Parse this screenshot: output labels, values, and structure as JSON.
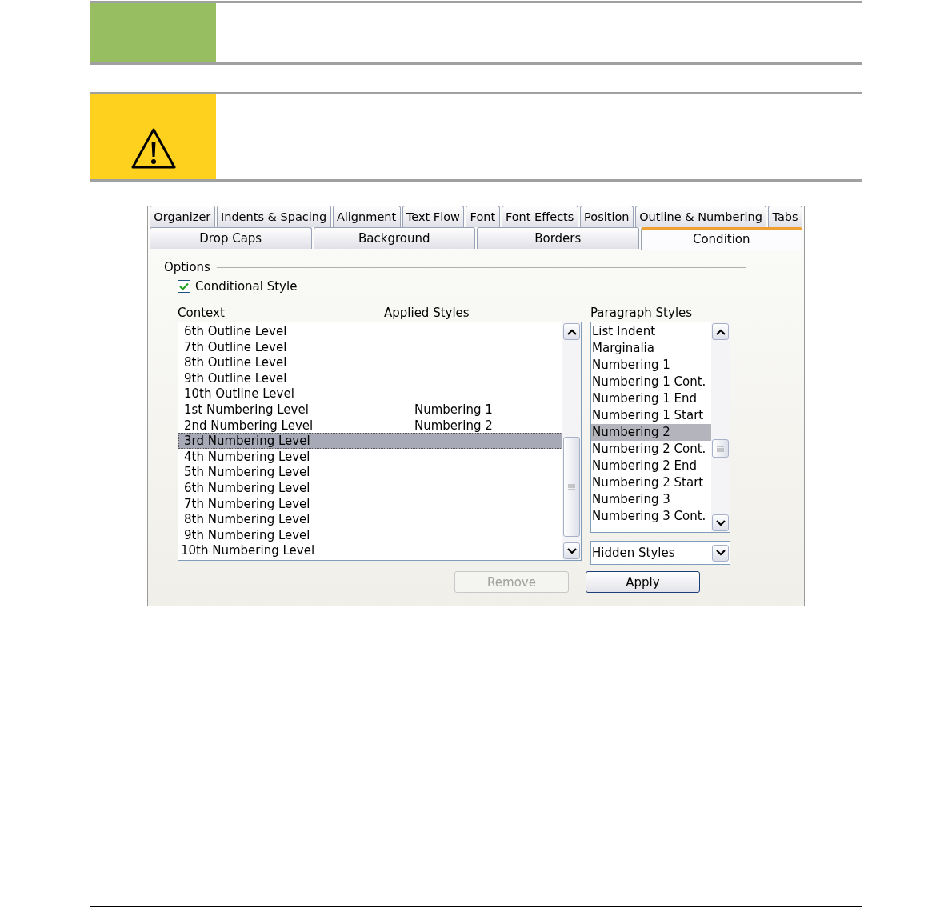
{
  "notes": [
    {
      "kind": "tip"
    },
    {
      "kind": "caution"
    }
  ],
  "dialog": {
    "tab_rows": [
      [
        {
          "label": "Organizer",
          "selected": false
        },
        {
          "label": "Indents & Spacing",
          "selected": false
        },
        {
          "label": "Alignment",
          "selected": false
        },
        {
          "label": "Text Flow",
          "selected": false
        },
        {
          "label": "Font",
          "selected": false
        },
        {
          "label": "Font Effects",
          "selected": false
        },
        {
          "label": "Position",
          "selected": false
        },
        {
          "label": "Outline & Numbering",
          "selected": false
        },
        {
          "label": "Tabs",
          "selected": false
        }
      ],
      [
        {
          "label": "Drop Caps",
          "selected": false
        },
        {
          "label": "Background",
          "selected": false
        },
        {
          "label": "Borders",
          "selected": false
        },
        {
          "label": "Condition",
          "selected": true
        }
      ]
    ],
    "options_label": "Options",
    "conditional_style": {
      "label": "Conditional Style",
      "checked": true
    },
    "context_header": "Context",
    "applied_header": "Applied Styles",
    "paragraph_header": "Paragraph Styles",
    "context_rows": [
      {
        "context": "6th Outline Level",
        "selected": false
      },
      {
        "context": "7th Outline Level",
        "selected": false
      },
      {
        "context": "8th Outline Level",
        "selected": false
      },
      {
        "context": "9th Outline Level",
        "selected": false
      },
      {
        "context": "10th Outline Level",
        "selected": false
      },
      {
        "context": "1st Numbering Level",
        "applied": "Numbering 1",
        "selected": false
      },
      {
        "context": "2nd Numbering Level",
        "applied": "Numbering 2",
        "selected": false
      },
      {
        "context": "3rd Numbering Level",
        "selected": true
      },
      {
        "context": "4th Numbering Level",
        "selected": false
      },
      {
        "context": "5th Numbering Level",
        "selected": false
      },
      {
        "context": "6th Numbering Level",
        "selected": false
      },
      {
        "context": "7th Numbering Level",
        "selected": false
      },
      {
        "context": "8th Numbering Level",
        "selected": false
      },
      {
        "context": "9th Numbering Level",
        "selected": false
      },
      {
        "context": "10th Numbering Level",
        "selected": false
      }
    ],
    "paragraph_styles": [
      {
        "label": "List Indent",
        "selected": false
      },
      {
        "label": "Marginalia",
        "selected": false
      },
      {
        "label": "Numbering 1",
        "selected": false
      },
      {
        "label": "Numbering 1 Cont.",
        "selected": false
      },
      {
        "label": "Numbering 1 End",
        "selected": false
      },
      {
        "label": "Numbering 1 Start",
        "selected": false
      },
      {
        "label": "Numbering 2",
        "selected": true
      },
      {
        "label": "Numbering 2 Cont.",
        "selected": false
      },
      {
        "label": "Numbering 2 End",
        "selected": false
      },
      {
        "label": "Numbering 2 Start",
        "selected": false
      },
      {
        "label": "Numbering 3",
        "selected": false
      },
      {
        "label": "Numbering 3 Cont.",
        "selected": false
      }
    ],
    "style_filter": {
      "value": "Hidden Styles"
    },
    "buttons": [
      {
        "label": "Remove",
        "disabled": true
      },
      {
        "label": "Apply",
        "disabled": false
      }
    ]
  }
}
